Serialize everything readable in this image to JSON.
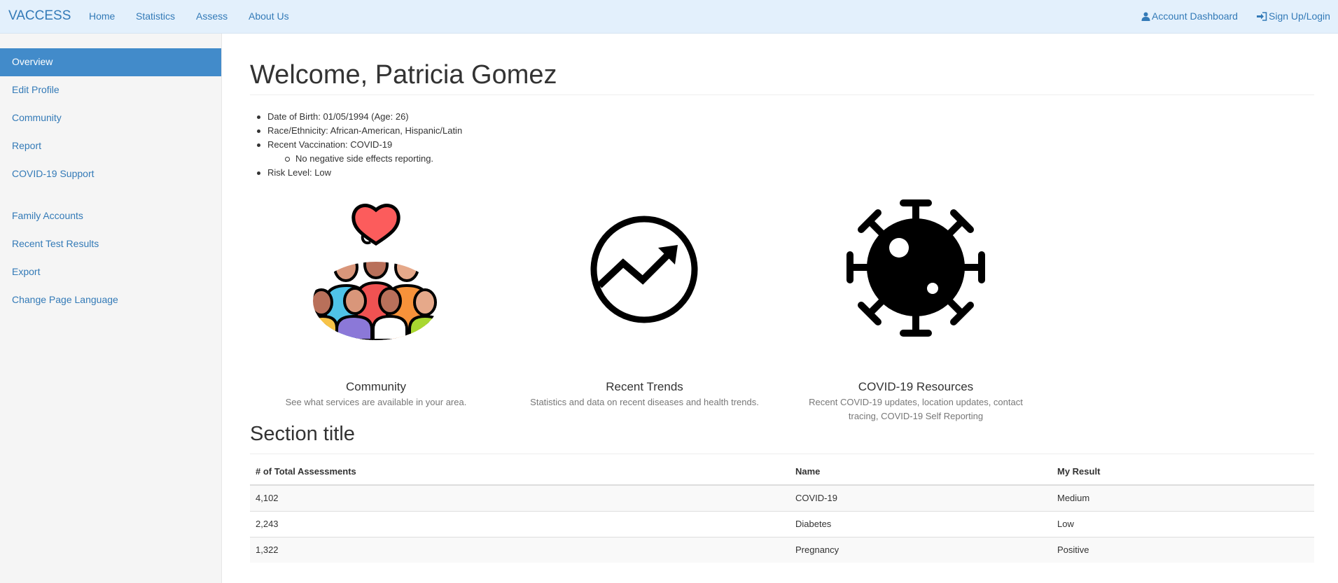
{
  "navbar": {
    "brand": "VACCESS",
    "links": [
      "Home",
      "Statistics",
      "Assess",
      "About Us"
    ],
    "account_dashboard": "Account Dashboard",
    "sign_up_login": "Sign Up/Login"
  },
  "sidebar": {
    "items": [
      {
        "label": "Overview",
        "active": true
      },
      {
        "label": "Edit Profile"
      },
      {
        "label": "Community"
      },
      {
        "label": "Report"
      },
      {
        "label": "COVID-19 Support"
      },
      {
        "label": "Family Accounts"
      },
      {
        "label": "Recent Test Results"
      },
      {
        "label": "Export"
      },
      {
        "label": "Change Page Language"
      }
    ]
  },
  "profile": {
    "welcome": "Welcome, Patricia Gomez",
    "dob": "Date of Birth: 01/05/1994 (Age: 26)",
    "race": "Race/Ethnicity: African-American, Hispanic/Latin",
    "vaccination": "Recent Vaccination: COVID-19",
    "side_effects": "No negative side effects reporting.",
    "risk": "Risk Level: Low"
  },
  "features": [
    {
      "title": "Community",
      "description": "See what services are available in your area.",
      "icon": "community-icon"
    },
    {
      "title": "Recent Trends",
      "description": "Statistics and data on recent diseases and health trends.",
      "icon": "trend-icon"
    },
    {
      "title": "COVID-19 Resources",
      "description": "Recent COVID-19 updates, location updates, contact tracing, COVID-19 Self Reporting",
      "icon": "virus-icon"
    }
  ],
  "section": {
    "title": "Section title",
    "table": {
      "headers": [
        "# of Total Assessments",
        "Name",
        "My Result"
      ],
      "rows": [
        [
          "4,102",
          "COVID-19",
          "Medium"
        ],
        [
          "2,243",
          "Diabetes",
          "Low"
        ],
        [
          "1,322",
          "Pregnancy",
          "Positive"
        ]
      ]
    }
  },
  "colors": {
    "navbar_bg": "#e3f0fc",
    "link": "#337ab7",
    "active_bg": "#428bca"
  }
}
